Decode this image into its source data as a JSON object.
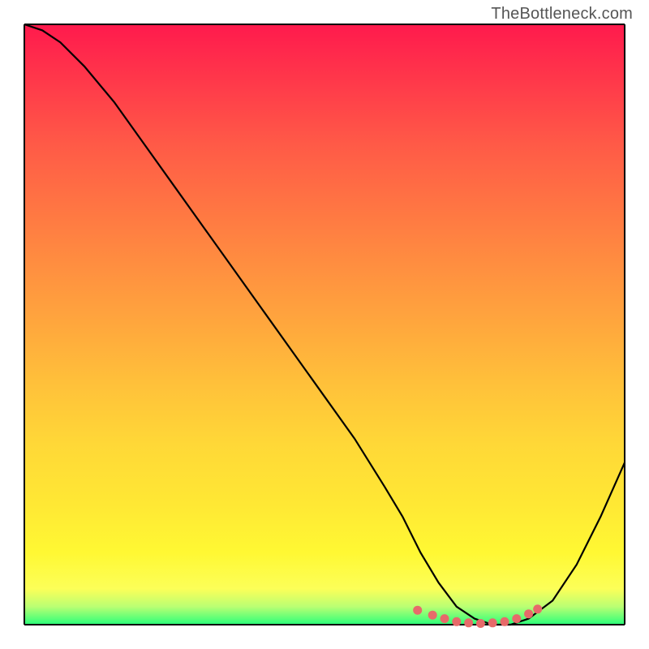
{
  "watermark": "TheBottleneck.com",
  "chart_data": {
    "type": "line",
    "title": "",
    "xlabel": "",
    "ylabel": "",
    "xlim": [
      0,
      100
    ],
    "ylim": [
      0,
      100
    ],
    "grid": false,
    "series": [
      {
        "name": "bottleneck-curve",
        "x": [
          0,
          3,
          6,
          10,
          15,
          20,
          25,
          30,
          35,
          40,
          45,
          50,
          55,
          60,
          63,
          66,
          69,
          72,
          75,
          78,
          81,
          84,
          88,
          92,
          96,
          100
        ],
        "values": [
          100,
          99,
          97,
          93,
          87,
          80,
          73,
          66,
          59,
          52,
          45,
          38,
          31,
          23,
          18,
          12,
          7,
          3,
          1,
          0,
          0,
          1,
          4,
          10,
          18,
          27
        ]
      }
    ],
    "highlight_points": {
      "name": "optimal-range",
      "color": "#e76a6a",
      "x": [
        65.5,
        68,
        70,
        72,
        74,
        76,
        78,
        80,
        82,
        84,
        85.5
      ],
      "values": [
        2.4,
        1.6,
        1.0,
        0.5,
        0.3,
        0.2,
        0.3,
        0.5,
        1.0,
        1.8,
        2.6
      ]
    },
    "colors": {
      "curve": "#000000",
      "points": "#e76a6a",
      "gradient_top": "#ff1a4d",
      "gradient_bottom": "#2aff7a"
    }
  }
}
